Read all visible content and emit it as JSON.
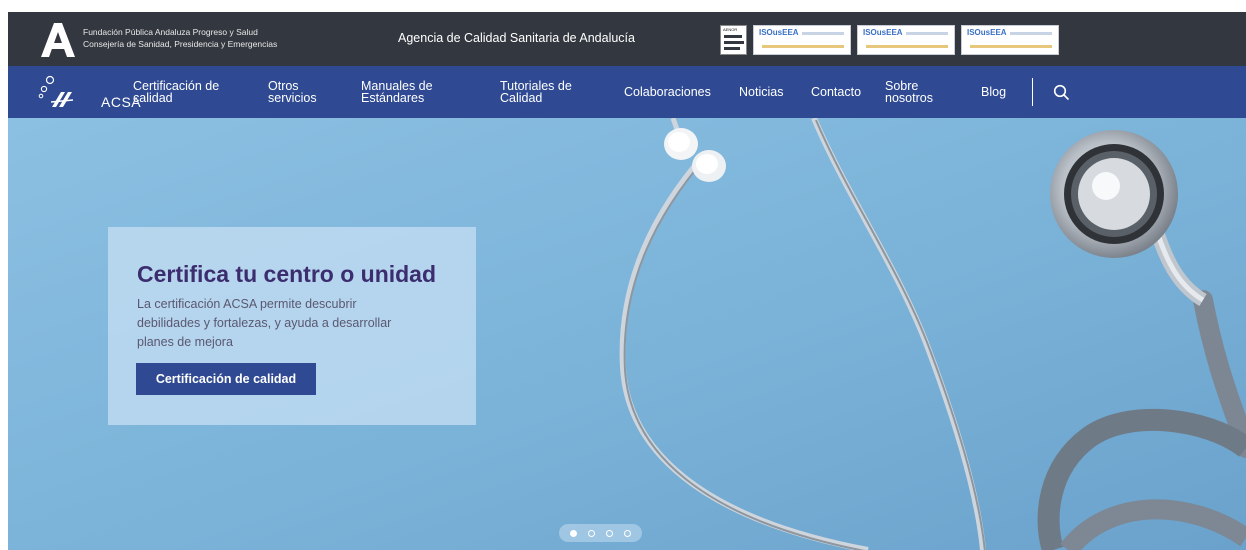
{
  "topbar": {
    "foundation_line1": "Fundación Pública Andaluza Progreso y Salud",
    "foundation_line2": "Consejería de Sanidad, Presidencia y Emergencias",
    "agency_name": "Agencia de Calidad Sanitaria de Andalucía",
    "badges": [
      {
        "label": "AENOR"
      },
      {
        "label": "ISOusEEA"
      },
      {
        "label": "ISOusEEA"
      },
      {
        "label": "ISOusEEA"
      }
    ]
  },
  "nav": {
    "brand": "ACSA",
    "items": [
      {
        "line1": "Certificación de",
        "line2": "calidad"
      },
      {
        "line1": "Otros",
        "line2": "servicios"
      },
      {
        "line1": "Manuales de",
        "line2": "Estándares"
      },
      {
        "line1": "Tutoriales de",
        "line2": "Calidad"
      },
      {
        "line1": "Colaboraciones",
        "line2": ""
      },
      {
        "line1": "Noticias",
        "line2": ""
      },
      {
        "line1": "Contacto",
        "line2": ""
      },
      {
        "line1": "Sobre",
        "line2": "nosotros"
      },
      {
        "line1": "Blog",
        "line2": ""
      }
    ],
    "search_icon": "search-icon"
  },
  "hero": {
    "title": "Certifica tu centro o unidad",
    "desc_line1": "La certificación ACSA permite descubrir",
    "desc_line2": "debilidades y fortalezas, y ayuda a desarrollar",
    "desc_line3": "planes de mejora",
    "cta": "Certificación de calidad",
    "slides_total": 4,
    "slide_active": 1
  },
  "colors": {
    "topbar_bg": "#33373f",
    "nav_bg": "#2f4a92",
    "hero_bg": "#7bb3d9",
    "title": "#3b2d6e"
  }
}
